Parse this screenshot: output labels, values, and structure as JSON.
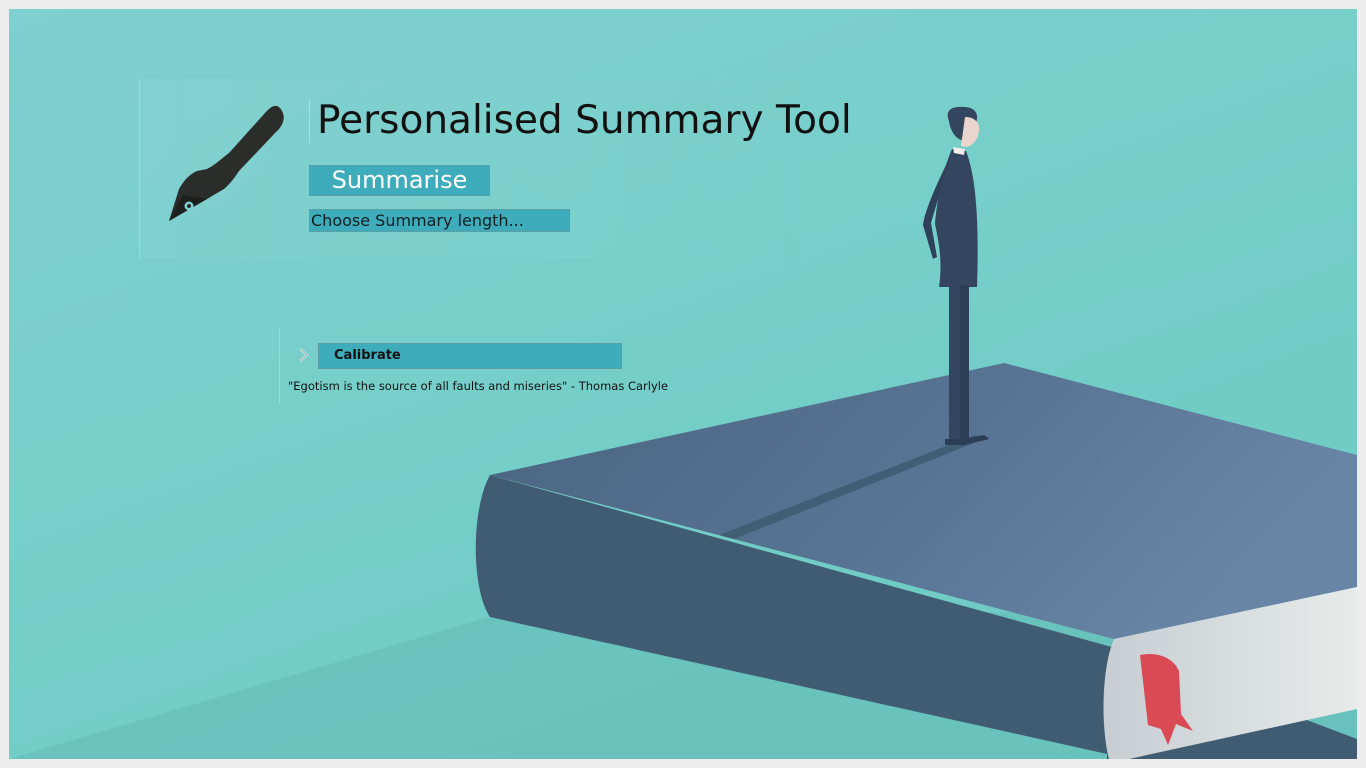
{
  "app": {
    "title": "Personalised Summary Tool"
  },
  "controls": {
    "summarise_label": "Summarise",
    "length_select_value": "Choose Summary length...",
    "calibrate_label": "Calibrate"
  },
  "quote": {
    "text": "\"Egotism is the source of all faults and miseries\" - Thomas Carlyle"
  },
  "icons": {
    "logo": "fountain-pen-icon",
    "calibrate_expand": "chevron-right-icon"
  },
  "colors": {
    "background": "#7fd0d0",
    "button": "#3eacbb",
    "book_cover": "#4d6a86",
    "book_spine": "#3f5c73",
    "bookmark": "#d94a55",
    "figure": "#33455f",
    "text": "#111111"
  }
}
